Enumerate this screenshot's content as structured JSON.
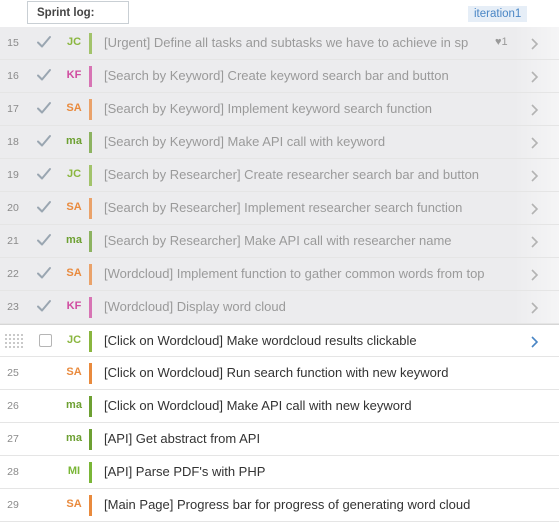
{
  "header": {
    "sprint_label": "Sprint log:",
    "iteration": "iteration1"
  },
  "colors": {
    "JC": "#8ab63f",
    "KF": "#d04ca0",
    "SA": "#e98a3d",
    "ma": "#6da032",
    "MI": "#7ab637",
    "done_check": "#9aa6b1",
    "open_chevron": "#4a86c5"
  },
  "rows": [
    {
      "num": "15",
      "state": "done",
      "avatar": "JC",
      "title": "[Urgent] Define all tasks and subtasks we have to achieve in sp",
      "like": "♥1"
    },
    {
      "num": "16",
      "state": "done",
      "avatar": "KF",
      "title": "[Search by Keyword] Create keyword search bar and button"
    },
    {
      "num": "17",
      "state": "done",
      "avatar": "SA",
      "title": "[Search by Keyword] Implement keyword search function"
    },
    {
      "num": "18",
      "state": "done",
      "avatar": "ma",
      "title": "[Search by Keyword] Make API call with keyword"
    },
    {
      "num": "19",
      "state": "done",
      "avatar": "JC",
      "title": "[Search by Researcher] Create researcher search bar and button"
    },
    {
      "num": "20",
      "state": "done",
      "avatar": "SA",
      "title": "[Search by Researcher] Implement researcher search function"
    },
    {
      "num": "21",
      "state": "done",
      "avatar": "ma",
      "title": "[Search by Researcher] Make API call with researcher name"
    },
    {
      "num": "22",
      "state": "done",
      "avatar": "SA",
      "title": "[Wordcloud] Implement function to gather common words from top"
    },
    {
      "num": "23",
      "state": "done",
      "avatar": "KF",
      "title": "[Wordcloud] Display word cloud"
    },
    {
      "num": "",
      "state": "open",
      "hover": true,
      "avatar": "JC",
      "title": "[Click on Wordcloud] Make wordcloud results clickable"
    },
    {
      "num": "25",
      "state": "open",
      "avatar": "SA",
      "title": "[Click on Wordcloud] Run search function with new keyword"
    },
    {
      "num": "26",
      "state": "open",
      "avatar": "ma",
      "title": "[Click on Wordcloud] Make API call with new keyword"
    },
    {
      "num": "27",
      "state": "open",
      "avatar": "ma",
      "title": "[API] Get abstract from API"
    },
    {
      "num": "28",
      "state": "open",
      "avatar": "MI",
      "title": "[API] Parse PDF's with PHP"
    },
    {
      "num": "29",
      "state": "open",
      "avatar": "SA",
      "title": "[Main Page] Progress bar for progress of generating word cloud"
    }
  ]
}
